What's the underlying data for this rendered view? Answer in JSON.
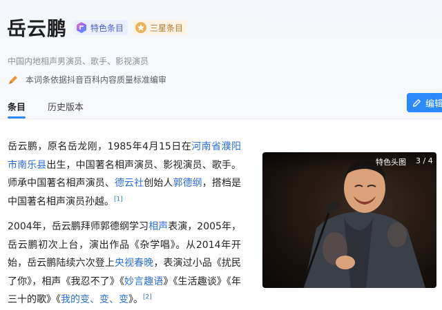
{
  "header": {
    "title": "岳云鹏",
    "badges": [
      {
        "label": "特色条目",
        "icon": "feature-icon"
      },
      {
        "label": "三星条目",
        "icon": "star-icon"
      }
    ],
    "subtitle": "中国内地相声男演员、歌手、影视演员",
    "note": "本词条依据抖音百科内容质量标准编审",
    "edit_label": "编辑"
  },
  "tabs": [
    {
      "label": "条目",
      "active": true
    },
    {
      "label": "历史版本",
      "active": false
    }
  ],
  "article": {
    "p1": {
      "t1": "岳云鹏，原名岳龙刚，1985年4月15日在",
      "l1": "河南省濮阳市南乐县",
      "t2": "出生，中国著名相声演员、影视演员、歌手。师承中国著名相声演员、",
      "l2": "德云社",
      "t3": "创始人",
      "l3": "郭德纲",
      "t4": "，搭档是中国著名相声演员孙越。",
      "ref": "[1]"
    },
    "p2": {
      "t1": "2004年，岳云鹏拜师郭德纲学习",
      "l1": "相声",
      "t2": "表演，2005年，岳云鹏初次上台，演出作品《杂学唱》。从2014年开始，岳云鹏陆续六次登上",
      "l2": "央视春晚",
      "t3": "，表演过小品《扰民了你》，相声《我忍不了》《",
      "l3": "妙言趣语",
      "t4": "》《生活趣谈》《年三十的歌》《",
      "l4": "我的变、变、变",
      "t5": "》。",
      "ref": "[2]"
    }
  },
  "photo": {
    "label": "特色头图",
    "counter": "3 / 4"
  },
  "colors": {
    "accent": "#2b8af7",
    "link": "#2b6fd6",
    "feature_badge_bg": "#eaf0ff",
    "star_badge_bg": "#fdf2e4"
  }
}
